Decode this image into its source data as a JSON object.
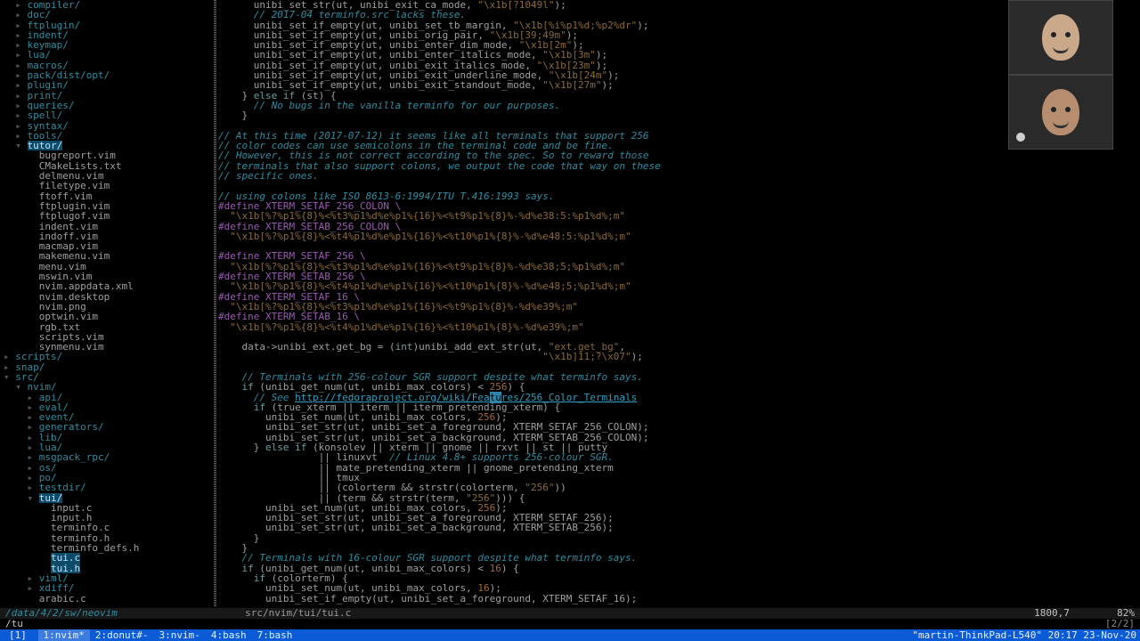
{
  "sidebar": {
    "rows": [
      {
        "indent": 1,
        "bullet": "▸",
        "label": "compiler/",
        "type": "dir"
      },
      {
        "indent": 1,
        "bullet": "▸",
        "label": "doc/",
        "type": "dir"
      },
      {
        "indent": 1,
        "bullet": "▸",
        "label": "ftplugin/",
        "type": "dir"
      },
      {
        "indent": 1,
        "bullet": "▸",
        "label": "indent/",
        "type": "dir"
      },
      {
        "indent": 1,
        "bullet": "▸",
        "label": "keymap/",
        "type": "dir"
      },
      {
        "indent": 1,
        "bullet": "▸",
        "label": "lua/",
        "type": "dir"
      },
      {
        "indent": 1,
        "bullet": "▸",
        "label": "macros/",
        "type": "dir"
      },
      {
        "indent": 1,
        "bullet": "▸",
        "label": "pack/dist/opt/",
        "type": "dir"
      },
      {
        "indent": 1,
        "bullet": "▸",
        "label": "plugin/",
        "type": "dir"
      },
      {
        "indent": 1,
        "bullet": "▸",
        "label": "print/",
        "type": "dir"
      },
      {
        "indent": 1,
        "bullet": "▸",
        "label": "queries/",
        "type": "dir"
      },
      {
        "indent": 1,
        "bullet": "▸",
        "label": "spell/",
        "type": "dir"
      },
      {
        "indent": 1,
        "bullet": "▸",
        "label": "syntax/",
        "type": "dir"
      },
      {
        "indent": 1,
        "bullet": "▸",
        "label": "tools/",
        "type": "dir"
      },
      {
        "indent": 1,
        "bullet": "▾",
        "label": "tutor/",
        "type": "dir",
        "selected": true
      },
      {
        "indent": 2,
        "bullet": " ",
        "label": "bugreport.vim",
        "type": "file"
      },
      {
        "indent": 2,
        "bullet": " ",
        "label": "CMakeLists.txt",
        "type": "file"
      },
      {
        "indent": 2,
        "bullet": " ",
        "label": "delmenu.vim",
        "type": "file"
      },
      {
        "indent": 2,
        "bullet": " ",
        "label": "filetype.vim",
        "type": "file"
      },
      {
        "indent": 2,
        "bullet": " ",
        "label": "ftoff.vim",
        "type": "file"
      },
      {
        "indent": 2,
        "bullet": " ",
        "label": "ftplugin.vim",
        "type": "file"
      },
      {
        "indent": 2,
        "bullet": " ",
        "label": "ftplugof.vim",
        "type": "file"
      },
      {
        "indent": 2,
        "bullet": " ",
        "label": "indent.vim",
        "type": "file"
      },
      {
        "indent": 2,
        "bullet": " ",
        "label": "indoff.vim",
        "type": "file"
      },
      {
        "indent": 2,
        "bullet": " ",
        "label": "macmap.vim",
        "type": "file"
      },
      {
        "indent": 2,
        "bullet": " ",
        "label": "makemenu.vim",
        "type": "file"
      },
      {
        "indent": 2,
        "bullet": " ",
        "label": "menu.vim",
        "type": "file"
      },
      {
        "indent": 2,
        "bullet": " ",
        "label": "mswin.vim",
        "type": "file"
      },
      {
        "indent": 2,
        "bullet": " ",
        "label": "nvim.appdata.xml",
        "type": "file"
      },
      {
        "indent": 2,
        "bullet": " ",
        "label": "nvim.desktop",
        "type": "file"
      },
      {
        "indent": 2,
        "bullet": " ",
        "label": "nvim.png",
        "type": "file"
      },
      {
        "indent": 2,
        "bullet": " ",
        "label": "optwin.vim",
        "type": "file"
      },
      {
        "indent": 2,
        "bullet": " ",
        "label": "rgb.txt",
        "type": "file"
      },
      {
        "indent": 2,
        "bullet": " ",
        "label": "scripts.vim",
        "type": "file"
      },
      {
        "indent": 2,
        "bullet": " ",
        "label": "synmenu.vim",
        "type": "file"
      },
      {
        "indent": 0,
        "bullet": "▸",
        "label": "scripts/",
        "type": "dir"
      },
      {
        "indent": 0,
        "bullet": "▸",
        "label": "snap/",
        "type": "dir"
      },
      {
        "indent": 0,
        "bullet": "▾",
        "label": "src/",
        "type": "dir"
      },
      {
        "indent": 1,
        "bullet": "▾",
        "label": "nvim/",
        "type": "dir"
      },
      {
        "indent": 2,
        "bullet": "▸",
        "label": "api/",
        "type": "dir"
      },
      {
        "indent": 2,
        "bullet": "▸",
        "label": "eval/",
        "type": "dir"
      },
      {
        "indent": 2,
        "bullet": "▸",
        "label": "event/",
        "type": "dir"
      },
      {
        "indent": 2,
        "bullet": "▸",
        "label": "generators/",
        "type": "dir"
      },
      {
        "indent": 2,
        "bullet": "▸",
        "label": "lib/",
        "type": "dir"
      },
      {
        "indent": 2,
        "bullet": "▸",
        "label": "lua/",
        "type": "dir"
      },
      {
        "indent": 2,
        "bullet": "▸",
        "label": "msgpack_rpc/",
        "type": "dir"
      },
      {
        "indent": 2,
        "bullet": "▸",
        "label": "os/",
        "type": "dir"
      },
      {
        "indent": 2,
        "bullet": "▸",
        "label": "po/",
        "type": "dir"
      },
      {
        "indent": 2,
        "bullet": "▸",
        "label": "testdir/",
        "type": "dir"
      },
      {
        "indent": 2,
        "bullet": "▾",
        "label": "tui/",
        "type": "dir",
        "selected": true
      },
      {
        "indent": 3,
        "bullet": " ",
        "label": "input.c",
        "type": "file"
      },
      {
        "indent": 3,
        "bullet": " ",
        "label": "input.h",
        "type": "file"
      },
      {
        "indent": 3,
        "bullet": " ",
        "label": "terminfo.c",
        "type": "file"
      },
      {
        "indent": 3,
        "bullet": " ",
        "label": "terminfo.h",
        "type": "file"
      },
      {
        "indent": 3,
        "bullet": " ",
        "label": "terminfo_defs.h",
        "type": "file"
      },
      {
        "indent": 3,
        "bullet": " ",
        "label": "tui.c",
        "type": "file",
        "selected": true
      },
      {
        "indent": 3,
        "bullet": " ",
        "label": "tui.h",
        "type": "file",
        "selected": true
      },
      {
        "indent": 2,
        "bullet": "▸",
        "label": "viml/",
        "type": "dir"
      },
      {
        "indent": 2,
        "bullet": "▸",
        "label": "xdiff/",
        "type": "dir"
      },
      {
        "indent": 2,
        "bullet": " ",
        "label": "arabic.c",
        "type": "file"
      }
    ]
  },
  "code_lines": [
    {
      "segments": [
        [
          "id",
          "      unibi_set_str(ut, unibi_exit_ca_mode, "
        ],
        [
          "str",
          "\"\\x1b[?1049l\""
        ],
        [
          "punc",
          ");"
        ]
      ]
    },
    {
      "segments": [
        [
          "cm",
          "      // 2017-04 terminfo.src lacks these."
        ]
      ]
    },
    {
      "segments": [
        [
          "id",
          "      unibi_set_if_empty(ut, unibi_set_tb_margin, "
        ],
        [
          "str",
          "\"\\x1b[%i%p1%d;%p2%dr\""
        ],
        [
          "punc",
          ");"
        ]
      ]
    },
    {
      "segments": [
        [
          "id",
          "      unibi_set_if_empty(ut, unibi_orig_pair, "
        ],
        [
          "str",
          "\"\\x1b[39;49m\""
        ],
        [
          "punc",
          ");"
        ]
      ]
    },
    {
      "segments": [
        [
          "id",
          "      unibi_set_if_empty(ut, unibi_enter_dim_mode, "
        ],
        [
          "str",
          "\"\\x1b[2m\""
        ],
        [
          "punc",
          ");"
        ]
      ]
    },
    {
      "segments": [
        [
          "id",
          "      unibi_set_if_empty(ut, unibi_enter_italics_mode, "
        ],
        [
          "str",
          "\"\\x1b[3m\""
        ],
        [
          "punc",
          ");"
        ]
      ]
    },
    {
      "segments": [
        [
          "id",
          "      unibi_set_if_empty(ut, unibi_exit_italics_mode, "
        ],
        [
          "str",
          "\"\\x1b[23m\""
        ],
        [
          "punc",
          ");"
        ]
      ]
    },
    {
      "segments": [
        [
          "id",
          "      unibi_set_if_empty(ut, unibi_exit_underline_mode, "
        ],
        [
          "str",
          "\"\\x1b[24m\""
        ],
        [
          "punc",
          ");"
        ]
      ]
    },
    {
      "segments": [
        [
          "id",
          "      unibi_set_if_empty(ut, unibi_exit_standout_mode, "
        ],
        [
          "str",
          "\"\\x1b[27m\""
        ],
        [
          "punc",
          ");"
        ]
      ]
    },
    {
      "segments": [
        [
          "punc",
          "    } "
        ],
        [
          "kw",
          "else if"
        ],
        [
          "punc",
          " (st) {"
        ]
      ]
    },
    {
      "segments": [
        [
          "cm",
          "      // No bugs in the vanilla terminfo for our purposes."
        ]
      ]
    },
    {
      "segments": [
        [
          "punc",
          "    }"
        ]
      ]
    },
    {
      "segments": [
        [
          "",
          ""
        ]
      ]
    },
    {
      "segments": [
        [
          "cm",
          "// At this time (2017-07-12) it seems like all terminals that support 256"
        ]
      ]
    },
    {
      "segments": [
        [
          "cm",
          "// color codes can use semicolons in the terminal code and be fine."
        ]
      ]
    },
    {
      "segments": [
        [
          "cm",
          "// However, this is not correct according to the spec. So to reward those"
        ]
      ]
    },
    {
      "segments": [
        [
          "cm",
          "// terminals that also support colons, we output the code that way on these"
        ]
      ]
    },
    {
      "segments": [
        [
          "cm",
          "// specific ones."
        ]
      ]
    },
    {
      "segments": [
        [
          "",
          ""
        ]
      ]
    },
    {
      "segments": [
        [
          "cm",
          "// using colons like ISO 8613-6:1994/ITU T.416:1993 says."
        ]
      ]
    },
    {
      "segments": [
        [
          "def",
          "#define XTERM_SETAF_256_COLON \\"
        ]
      ]
    },
    {
      "segments": [
        [
          "str",
          "  \"\\x1b[%?%p1%{8}%<%t3%p1%d%e%p1%{16}%<%t9%p1%{8}%-%d%e38:5:%p1%d%;m\""
        ]
      ]
    },
    {
      "segments": [
        [
          "def",
          "#define XTERM_SETAB_256_COLON \\"
        ]
      ]
    },
    {
      "segments": [
        [
          "str",
          "  \"\\x1b[%?%p1%{8}%<%t4%p1%d%e%p1%{16}%<%t10%p1%{8}%-%d%e48:5:%p1%d%;m\""
        ]
      ]
    },
    {
      "segments": [
        [
          "",
          ""
        ]
      ]
    },
    {
      "segments": [
        [
          "def",
          "#define XTERM_SETAF_256 \\"
        ]
      ]
    },
    {
      "segments": [
        [
          "str",
          "  \"\\x1b[%?%p1%{8}%<%t3%p1%d%e%p1%{16}%<%t9%p1%{8}%-%d%e38;5;%p1%d%;m\""
        ]
      ]
    },
    {
      "segments": [
        [
          "def",
          "#define XTERM_SETAB_256 \\"
        ]
      ]
    },
    {
      "segments": [
        [
          "str",
          "  \"\\x1b[%?%p1%{8}%<%t4%p1%d%e%p1%{16}%<%t10%p1%{8}%-%d%e48;5;%p1%d%;m\""
        ]
      ]
    },
    {
      "segments": [
        [
          "def",
          "#define XTERM_SETAF_16 \\"
        ]
      ]
    },
    {
      "segments": [
        [
          "str",
          "  \"\\x1b[%?%p1%{8}%<%t3%p1%d%e%p1%{16}%<%t9%p1%{8}%-%d%e39%;m\""
        ]
      ]
    },
    {
      "segments": [
        [
          "def",
          "#define XTERM_SETAB_16 \\"
        ]
      ]
    },
    {
      "segments": [
        [
          "str",
          "  \"\\x1b[%?%p1%{8}%<%t4%p1%d%e%p1%{16}%<%t10%p1%{8}%-%d%e39%;m\""
        ]
      ]
    },
    {
      "segments": [
        [
          "",
          ""
        ]
      ]
    },
    {
      "segments": [
        [
          "id",
          "    data->unibi_ext.get_bg = ("
        ],
        [
          "kw",
          "int"
        ],
        [
          "id",
          ")unibi_add_ext_str(ut, "
        ],
        [
          "str",
          "\"ext.get_bg\""
        ],
        [
          "punc",
          ","
        ]
      ]
    },
    {
      "segments": [
        [
          "id",
          "                                                       "
        ],
        [
          "str",
          "\"\\x1b]11;?\\x07\""
        ],
        [
          "punc",
          ");"
        ]
      ]
    },
    {
      "segments": [
        [
          "",
          ""
        ]
      ]
    },
    {
      "segments": [
        [
          "cm",
          "    // Terminals with 256-colour SGR support despite what terminfo says."
        ]
      ]
    },
    {
      "segments": [
        [
          "kw",
          "    if"
        ],
        [
          "id",
          " (unibi_get_num(ut, unibi_max_colors) < "
        ],
        [
          "num",
          "256"
        ],
        [
          "punc",
          ") {"
        ]
      ]
    },
    {
      "segments": [
        [
          "cm",
          "      // See "
        ],
        [
          "url",
          "http://fedoraproject.org/wiki/Fea"
        ],
        [
          "cursor",
          "tu"
        ],
        [
          "url",
          "res/256_Color_Terminals"
        ]
      ]
    },
    {
      "segments": [
        [
          "kw",
          "      if"
        ],
        [
          "id",
          " (true_xterm || iterm || iterm_pretending_xterm) {"
        ]
      ]
    },
    {
      "segments": [
        [
          "id",
          "        unibi_set_num(ut, unibi_max_colors, "
        ],
        [
          "num",
          "256"
        ],
        [
          "punc",
          ");"
        ]
      ]
    },
    {
      "segments": [
        [
          "id",
          "        unibi_set_str(ut, unibi_set_a_foreground, XTERM_SETAF_256_COLON);"
        ]
      ]
    },
    {
      "segments": [
        [
          "id",
          "        unibi_set_str(ut, unibi_set_a_background, XTERM_SETAB_256_COLON);"
        ]
      ]
    },
    {
      "segments": [
        [
          "punc",
          "      } "
        ],
        [
          "kw",
          "else if"
        ],
        [
          "id",
          " (konsolev || xterm || gnome || rxvt || st || putty"
        ]
      ]
    },
    {
      "segments": [
        [
          "id",
          "                 || linuxvt  "
        ],
        [
          "cm",
          "// Linux 4.8+ supports 256-colour SGR."
        ]
      ]
    },
    {
      "segments": [
        [
          "id",
          "                 || mate_pretending_xterm || gnome_pretending_xterm"
        ]
      ]
    },
    {
      "segments": [
        [
          "id",
          "                 || tmux"
        ]
      ]
    },
    {
      "segments": [
        [
          "id",
          "                 || (colorterm && strstr(colorterm, "
        ],
        [
          "str",
          "\"256\""
        ],
        [
          "punc",
          "))"
        ]
      ]
    },
    {
      "segments": [
        [
          "id",
          "                 || (term && strstr(term, "
        ],
        [
          "str",
          "\"256\""
        ],
        [
          "punc",
          "))) {"
        ]
      ]
    },
    {
      "segments": [
        [
          "id",
          "        unibi_set_num(ut, unibi_max_colors, "
        ],
        [
          "num",
          "256"
        ],
        [
          "punc",
          ");"
        ]
      ]
    },
    {
      "segments": [
        [
          "id",
          "        unibi_set_str(ut, unibi_set_a_foreground, XTERM_SETAF_256);"
        ]
      ]
    },
    {
      "segments": [
        [
          "id",
          "        unibi_set_str(ut, unibi_set_a_background, XTERM_SETAB_256);"
        ]
      ]
    },
    {
      "segments": [
        [
          "punc",
          "      }"
        ]
      ]
    },
    {
      "segments": [
        [
          "punc",
          "    }"
        ]
      ]
    },
    {
      "segments": [
        [
          "cm",
          "    // Terminals with 16-colour SGR support despite what terminfo says."
        ]
      ]
    },
    {
      "segments": [
        [
          "kw",
          "    if"
        ],
        [
          "id",
          " (unibi_get_num(ut, unibi_max_colors) < "
        ],
        [
          "num",
          "16"
        ],
        [
          "punc",
          ") {"
        ]
      ]
    },
    {
      "segments": [
        [
          "kw",
          "      if"
        ],
        [
          "id",
          " (colorterm) {"
        ]
      ]
    },
    {
      "segments": [
        [
          "id",
          "        unibi_set_num(ut, unibi_max_colors, "
        ],
        [
          "num",
          "16"
        ],
        [
          "punc",
          ");"
        ]
      ]
    },
    {
      "segments": [
        [
          "id",
          "        unibi_set_if_empty(ut, unibi_set_a_foreground, XTERM_SETAF_16);"
        ]
      ]
    }
  ],
  "status": {
    "cwd": "/data/4/2/sw/neovim",
    "file": "src/nvim/tui/tui.c",
    "pos": "1800,7",
    "pct": "82%"
  },
  "search": {
    "query": "/tu",
    "counter": "[2/2]"
  },
  "tmux": {
    "session": "[1]",
    "tabs": [
      "1:nvim*",
      "2:donut#-",
      "3:nvim-",
      "4:bash",
      "7:bash"
    ],
    "right": "\"martin-ThinkPad-L540\" 20:17 23-Nov-20"
  }
}
